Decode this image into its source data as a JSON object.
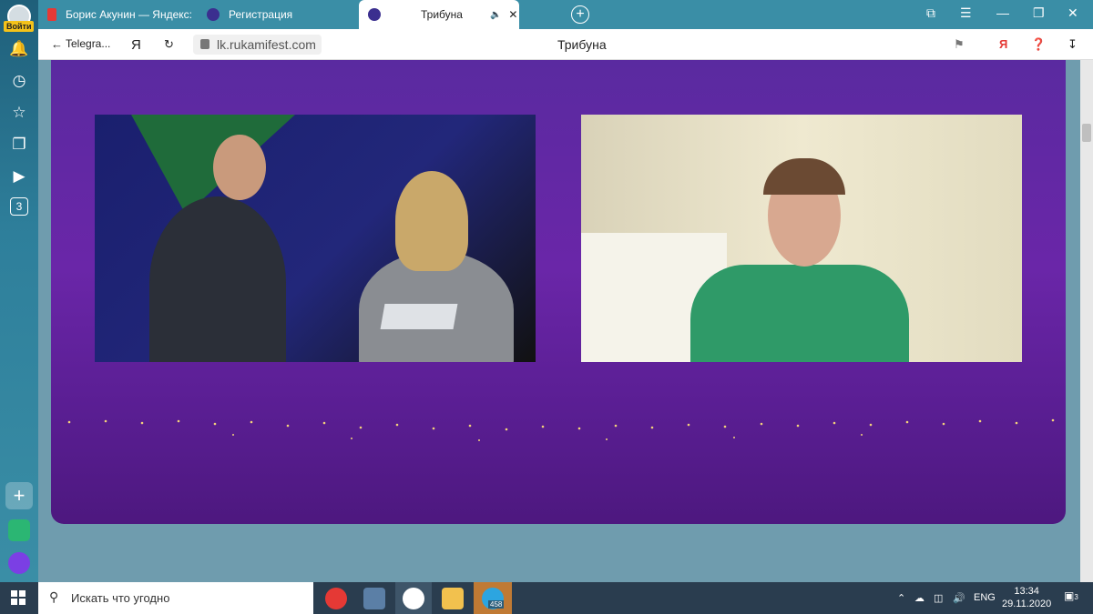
{
  "sidebar": {
    "login_label": "Войти",
    "badge_count": "3"
  },
  "tabs": [
    {
      "label": "Борис Акунин — Яндекс:"
    },
    {
      "label": "Регистрация"
    },
    {
      "label": "Трибуна"
    }
  ],
  "toolbar": {
    "back_label": "Telegra...",
    "yandex_label": "Я",
    "url": "lk.rukamifest.com",
    "page_title": "Трибуна"
  },
  "taskbar": {
    "search_placeholder": "Искать что угодно",
    "telegram_badge": "458",
    "lang": "ENG",
    "time": "13:34",
    "date": "29.11.2020",
    "notif_count": "3"
  },
  "colors": {
    "stage_purple": "#6a26a8",
    "browser_accent": "#3a8ea6",
    "page_bg": "#6f9cae",
    "taskbar": "#2a3d4f"
  }
}
